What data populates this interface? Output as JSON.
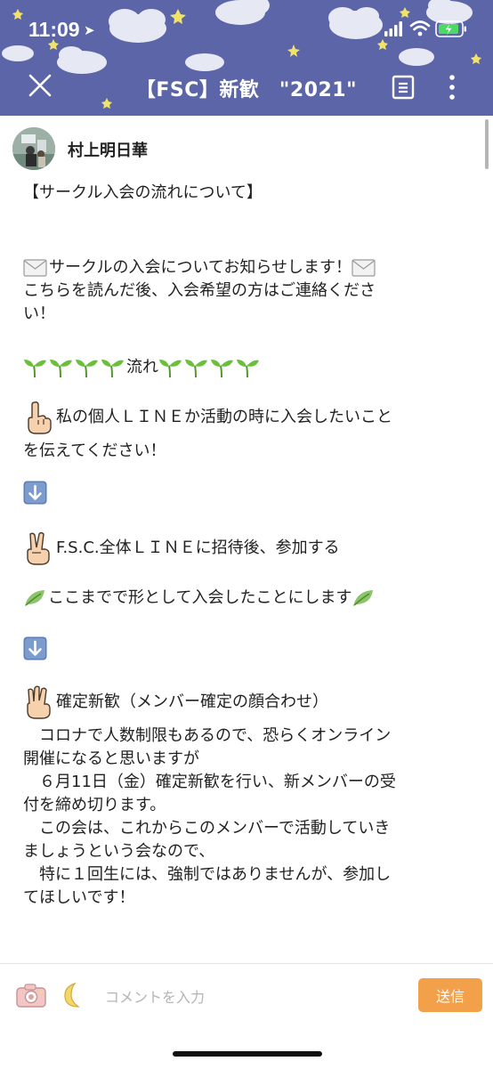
{
  "status_bar": {
    "time": "11:09"
  },
  "header": {
    "title": "【FSC】新歓　\"2021\""
  },
  "post": {
    "author": "村上明日華",
    "heading": "【サークル入会の流れについて】",
    "intro_line1": "サークルの入会についてお知らせします！",
    "intro_line2": "こちらを読んだ後、入会希望の方はご連絡くださ",
    "intro_line3": "い！",
    "flow_label": "流れ",
    "step1_line1": "私の個人ＬＩＮＥか活動の時に入会したいこと",
    "step1_line2": "を伝えてください！",
    "step2": "F.S.C.全体ＬＩＮＥに招待後、参加する",
    "joined_note": "ここまでで形として入会したことにします",
    "step3": "確定新歓（メンバー確定の顔合わせ）",
    "body_line1": "　コロナで人数制限もあるので、恐らくオンライン",
    "body_line2": "開催になると思いますが",
    "body_line3": "　６月11日（金）確定新歓を行い、新メンバーの受",
    "body_line4": "付を締め切ります。",
    "body_line5": "　この会は、これからこのメンバーで活動していき",
    "body_line6": "ましょうという会なので、",
    "body_line7": "　特に１回生には、強制ではありませんが、参加し",
    "body_line8": "てほしいです！"
  },
  "comment_bar": {
    "placeholder": "コメントを入力",
    "send_label": "送信"
  },
  "colors": {
    "header_bg": "#5b65a8",
    "send_button": "#f2a04a",
    "sprout": "#6cbf3a",
    "down_arrow_box": "#5b7fb5"
  },
  "icons": [
    "close-icon",
    "menu-icon",
    "more-icon",
    "camera-icon",
    "moon-icon",
    "envelope-icon",
    "sprout-icon",
    "leaf-icon",
    "down-arrow-icon",
    "hand-one-icon",
    "hand-two-icon",
    "hand-three-icon"
  ]
}
